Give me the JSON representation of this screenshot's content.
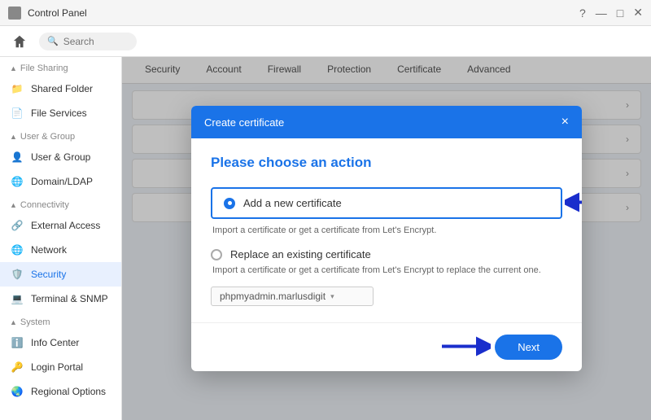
{
  "titleBar": {
    "title": "Control Panel",
    "controls": [
      "?",
      "—",
      "□",
      "✕"
    ]
  },
  "topNav": {
    "searchPlaceholder": "Search"
  },
  "tabs": {
    "items": [
      "Security",
      "Account",
      "Firewall",
      "Protection",
      "Certificate",
      "Advanced"
    ]
  },
  "sidebar": {
    "sections": [
      {
        "label": "File Sharing",
        "items": [
          {
            "name": "sidebar-item-shared-folder",
            "label": "Shared Folder",
            "icon": "folder"
          },
          {
            "name": "sidebar-item-file-services",
            "label": "File Services",
            "icon": "file"
          }
        ]
      },
      {
        "label": "User & Group",
        "items": [
          {
            "name": "sidebar-item-user-group",
            "label": "User & Group",
            "icon": "user"
          },
          {
            "name": "sidebar-item-domain-ldap",
            "label": "Domain/LDAP",
            "icon": "domain"
          }
        ]
      },
      {
        "label": "Connectivity",
        "items": [
          {
            "name": "sidebar-item-external-access",
            "label": "External Access",
            "icon": "external"
          },
          {
            "name": "sidebar-item-network",
            "label": "Network",
            "icon": "network"
          },
          {
            "name": "sidebar-item-security",
            "label": "Security",
            "icon": "shield",
            "active": true
          },
          {
            "name": "sidebar-item-terminal",
            "label": "Terminal & SNMP",
            "icon": "terminal"
          }
        ]
      },
      {
        "label": "System",
        "items": [
          {
            "name": "sidebar-item-info-center",
            "label": "Info Center",
            "icon": "info"
          },
          {
            "name": "sidebar-item-login-portal",
            "label": "Login Portal",
            "icon": "login"
          },
          {
            "name": "sidebar-item-regional-options",
            "label": "Regional Options",
            "icon": "globe"
          }
        ]
      }
    ]
  },
  "panelItems": [
    {
      "label": ""
    },
    {
      "label": ""
    },
    {
      "label": ""
    },
    {
      "label": ""
    }
  ],
  "modal": {
    "title": "Create certificate",
    "closeLabel": "×",
    "heading": "Please choose an action",
    "option1": {
      "label": "Add a new certificate",
      "description": "Import a certificate or get a certificate from Let's Encrypt.",
      "selected": true
    },
    "option2": {
      "label": "Replace an existing certificate",
      "description": "Import a certificate or get a certificate from Let's Encrypt to replace the current one.",
      "selected": false
    },
    "dropdown": {
      "value": "phpmyadmin.marlusdigit",
      "placeholder": "phpmyadmin.marlusdigit ▾"
    },
    "nextButton": "Next"
  }
}
